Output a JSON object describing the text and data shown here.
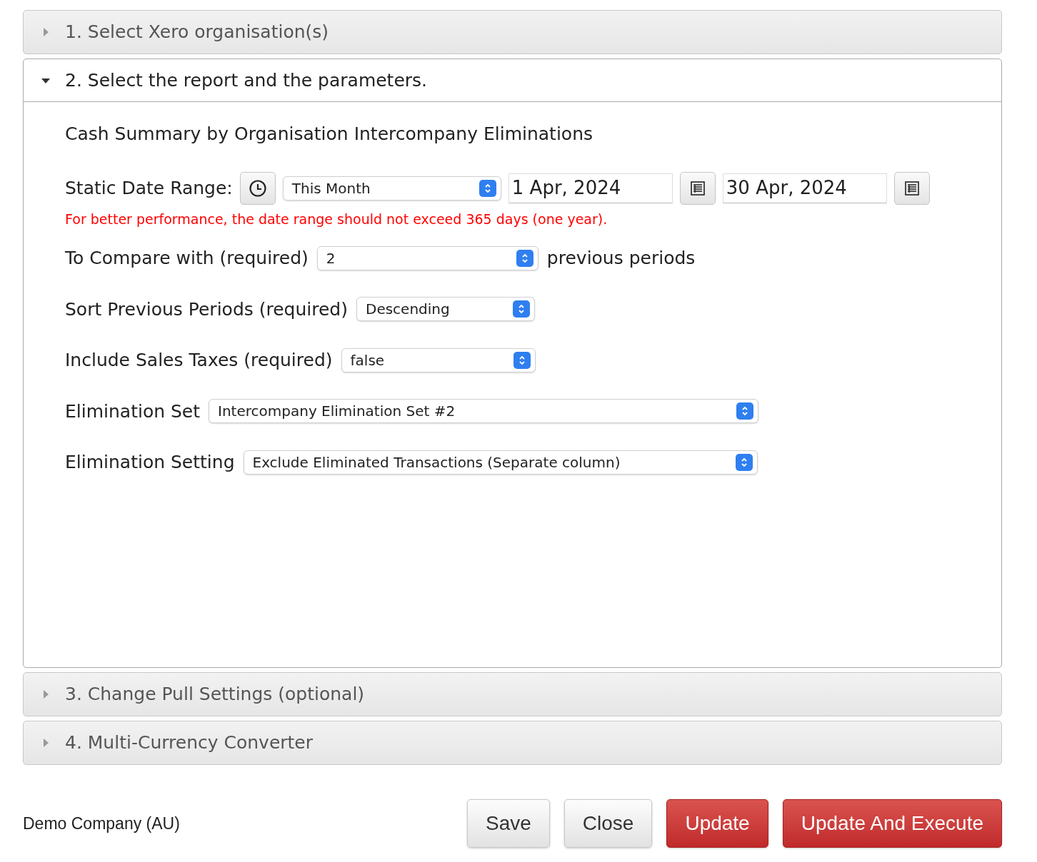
{
  "sections": [
    {
      "title": "1. Select Xero organisation(s)",
      "expanded": false
    },
    {
      "title": "2. Select the report and the parameters.",
      "expanded": true
    },
    {
      "title": "3. Change Pull Settings (optional)",
      "expanded": false
    },
    {
      "title": "4. Multi-Currency Converter",
      "expanded": false
    }
  ],
  "report": {
    "title": "Cash Summary by Organisation Intercompany Eliminations",
    "date_range": {
      "label": "Static Date Range:",
      "preset": "This Month",
      "start": "1 Apr, 2024",
      "end": "30 Apr, 2024",
      "warning": "For better performance, the date range should not exceed 365 days (one year)."
    },
    "params": [
      {
        "label": "To Compare with (required)",
        "value": "2",
        "suffix": "previous periods"
      },
      {
        "label": "Sort Previous Periods (required)",
        "value": "Descending"
      },
      {
        "label": "Include Sales Taxes (required)",
        "value": "false"
      },
      {
        "label": "Elimination Set",
        "value": "Intercompany Elimination Set #2"
      },
      {
        "label": "Elimination Setting",
        "value": "Exclude Eliminated Transactions (Separate column)"
      }
    ]
  },
  "footer": {
    "company": "Demo Company (AU)",
    "buttons": [
      {
        "label": "Save",
        "kind": "default"
      },
      {
        "label": "Close",
        "kind": "default"
      },
      {
        "label": "Update",
        "kind": "primary"
      },
      {
        "label": "Update And Execute",
        "kind": "primary"
      }
    ]
  }
}
